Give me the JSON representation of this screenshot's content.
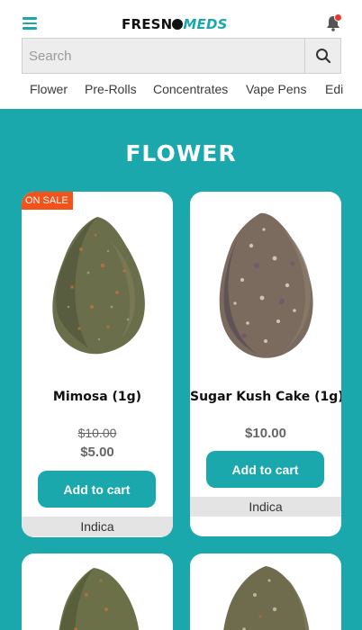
{
  "header": {
    "menu_icon": "hamburger-menu-icon",
    "logo_part1": "FRESN",
    "logo_part2": "MEDS",
    "bell_icon": "bell-icon",
    "accent": "#1aa8ad"
  },
  "search": {
    "placeholder": "Search",
    "icon": "search-icon"
  },
  "categories": [
    "Flower",
    "Pre-Rolls",
    "Concentrates",
    "Vape Pens",
    "Edi"
  ],
  "section": {
    "title": "FLOWER",
    "background": "#1aa8ad"
  },
  "products": [
    {
      "badge": "ON SALE",
      "name": "Mimosa (1g)",
      "old_price": "$10.00",
      "price": "$5.00",
      "button": "Add to cart",
      "strain": "Indica"
    },
    {
      "name": "Sugar Kush Cake (1g)",
      "price": "$10.00",
      "button": "Add to cart",
      "strain": "Indica"
    }
  ]
}
